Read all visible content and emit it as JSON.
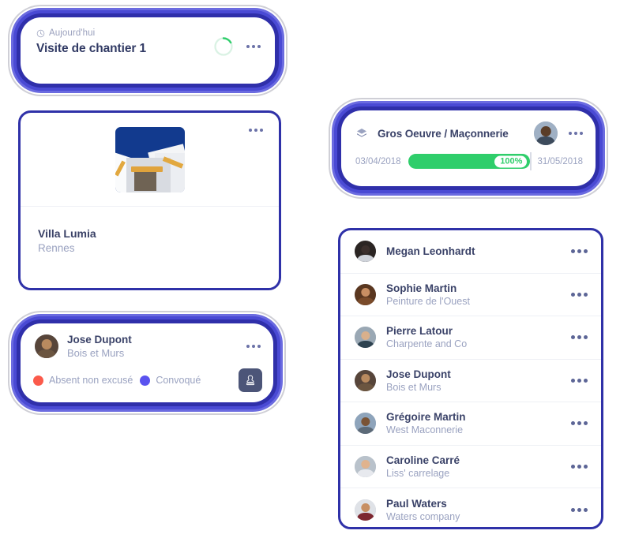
{
  "today_card": {
    "icon": "clock-icon",
    "meta": "Aujourd'hui",
    "title": "Visite de chantier 1",
    "progress_ring": {
      "name": "progress-ring-icon",
      "percent": 18,
      "track_color": "#d8f3e2",
      "arc_color": "#2fce6b"
    },
    "menu": "more-options-icon"
  },
  "villa_card": {
    "photo_alt": "villa-photo",
    "name": "Villa Lumia",
    "location": "Rennes",
    "menu": "more-options-icon"
  },
  "gantt_card": {
    "icon": "layers-cube-icon",
    "title": "Gros Oeuvre / Maçonnerie",
    "avatar": "avatar-gros-oeuvre",
    "menu": "more-options-icon",
    "start_date": "03/04/2018",
    "end_date": "31/05/2018",
    "percent_label": "100%",
    "percent_value": 100,
    "bar_color": "#2fce6b"
  },
  "jose_card": {
    "avatar": "avatar-jose-dupont",
    "name": "Jose Dupont",
    "company": "Bois et Murs",
    "menu": "more-options-icon",
    "legend": [
      {
        "label": "Absent non excusé",
        "color": "#fb5a4b"
      },
      {
        "label": "Convoqué",
        "color": "#5a53ef"
      }
    ],
    "action_button": {
      "icon": "stamp-pen-icon",
      "bg": "#4c5578"
    }
  },
  "contacts_card": {
    "menu_icon": "more-options-icon",
    "rows": [
      {
        "avatar": "avatar-megan-leonhardt",
        "name": "Megan Leonhardt",
        "company": "",
        "skin": "#3b2f2c",
        "hair": "#1b1513",
        "cloth": "#cfd3da",
        "bg": "#2b2523"
      },
      {
        "avatar": "avatar-sophie-martin",
        "name": "Sophie Martin",
        "company": "Peinture de l'Ouest",
        "skin": "#c98f63",
        "hair": "#4a2f1d",
        "cloth": "#7a4b2a",
        "bg": "#5a3720"
      },
      {
        "avatar": "avatar-pierre-latour",
        "name": "Pierre Latour",
        "company": "Charpente and Co",
        "skin": "#d9b08c",
        "hair": "#2f3a46",
        "cloth": "#2d4250",
        "bg": "#9aa8b4"
      },
      {
        "avatar": "avatar-jose-dupont",
        "name": "Jose Dupont",
        "company": "Bois et Murs",
        "skin": "#b98a5f",
        "hair": "#2a211b",
        "cloth": "#6b5540",
        "bg": "#57453a"
      },
      {
        "avatar": "avatar-gregoire-martin",
        "name": "Grégoire Martin",
        "company": "West Maconnerie",
        "skin": "#7a5335",
        "hair": "#201a16",
        "cloth": "#5c6a78",
        "bg": "#8ea4bb"
      },
      {
        "avatar": "avatar-caroline-carre",
        "name": "Caroline  Carré",
        "company": "Liss' carrelage",
        "skin": "#e0b38e",
        "hair": "#3a2a22",
        "cloth": "#e7e9ee",
        "bg": "#b9c2cb"
      },
      {
        "avatar": "avatar-paul-waters",
        "name": "Paul Waters",
        "company": "Waters company",
        "skin": "#c78f63",
        "hair": "#241c17",
        "cloth": "#7d2730",
        "bg": "#dfe2e7"
      }
    ]
  }
}
